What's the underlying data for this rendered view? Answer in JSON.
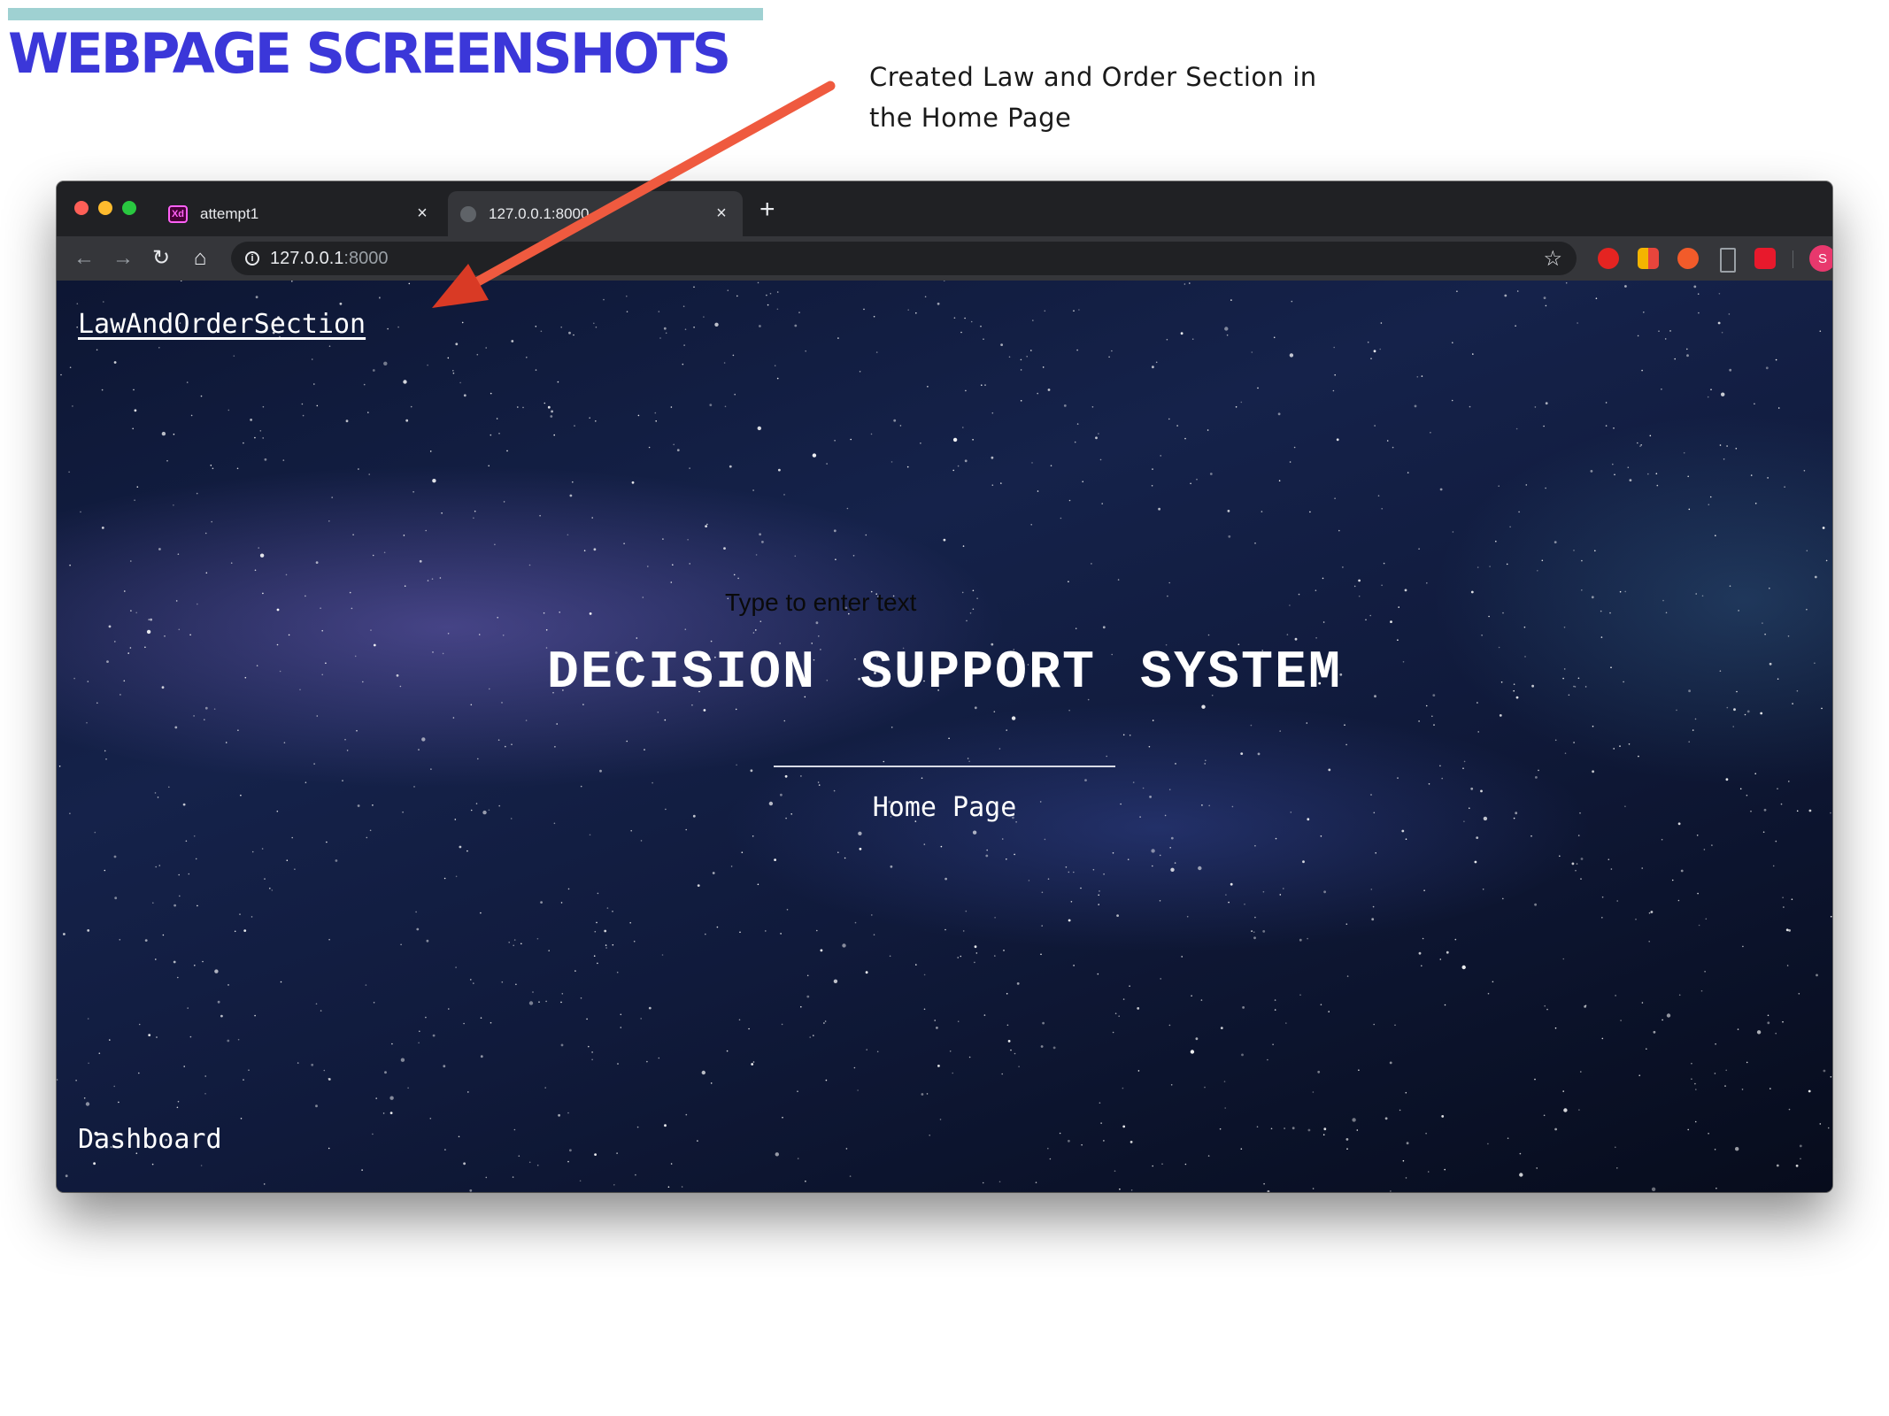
{
  "slide": {
    "title": "WEBPAGE SCREENSHOTS",
    "annotation_line1": "Created Law and Order Section in",
    "annotation_line2": "the Home Page"
  },
  "browser": {
    "tabs": [
      {
        "label": "attempt1",
        "favicon": "adobe-xd-icon",
        "favicon_text": "Xd"
      },
      {
        "label": "127.0.0.1:8000",
        "favicon": "globe-icon",
        "active": true
      }
    ],
    "address_host": "127.0.0.1",
    "address_port": ":8000",
    "avatar_initial": "S",
    "extension_icons": [
      "adblock-icon",
      "colorful-ext-icon",
      "orange-ext-icon",
      "bookmark-ext-icon",
      "red-ext-icon"
    ]
  },
  "page": {
    "top_link": "LawAndOrderSection",
    "placeholder": "Type to enter text",
    "hero_title": "DECISION SUPPORT SYSTEM",
    "hero_subtitle": "Home Page",
    "bottom_link": "Dashboard"
  },
  "colors": {
    "title_blue": "#3b37d9",
    "rule_teal": "#9fd1d2",
    "arrow_red": "#e8452c",
    "space_bg": "#101a3b"
  }
}
